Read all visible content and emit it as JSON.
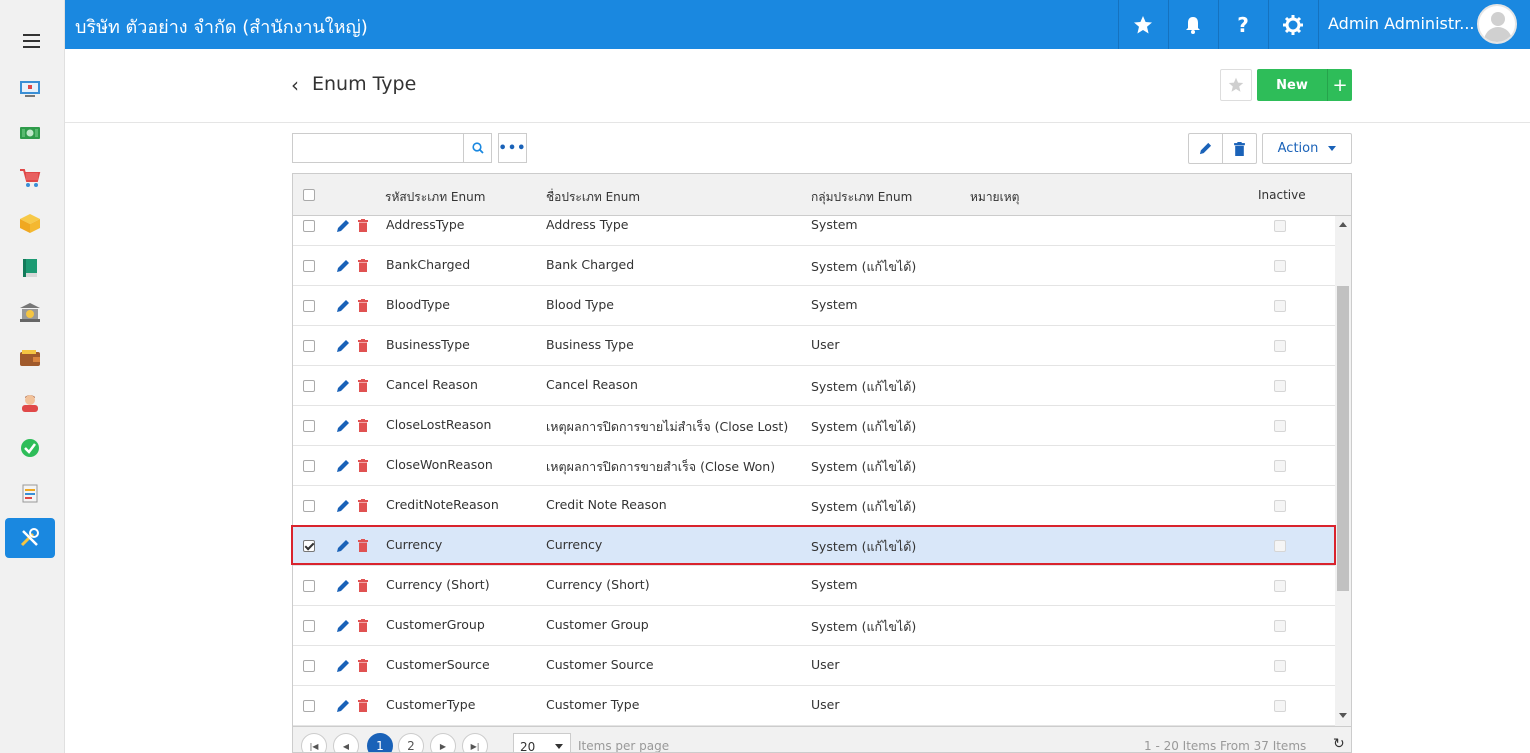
{
  "header": {
    "company": "บริษัท ตัวอย่าง จำกัด (สำนักงานใหญ่)",
    "user_name": "Admin Administr..."
  },
  "sidebar": {
    "items": [
      "dashboard-icon",
      "money-icon",
      "cart-icon",
      "box-icon",
      "book-icon",
      "bank-icon",
      "wallet-icon",
      "people-icon",
      "check-circle-icon",
      "report-icon",
      "tools-icon"
    ],
    "active_index": 10
  },
  "page": {
    "title": "Enum Type",
    "new_label": "New",
    "new_plus": "+",
    "action_label": "Action",
    "search_placeholder": ""
  },
  "grid": {
    "columns": {
      "code": "รหัสประเภท Enum",
      "name": "ชื่อประเภท Enum",
      "group": "กลุ่มประเภท Enum",
      "note": "หมายเหตุ",
      "inactive": "Inactive"
    },
    "rows": [
      {
        "code": "AddressType",
        "name": "Address Type",
        "group": "System",
        "note": "",
        "selected": false
      },
      {
        "code": "BankCharged",
        "name": "Bank Charged",
        "group": "System (แก้ไขได้)",
        "note": "",
        "selected": false
      },
      {
        "code": "BloodType",
        "name": "Blood Type",
        "group": "System",
        "note": "",
        "selected": false
      },
      {
        "code": "BusinessType",
        "name": "Business Type",
        "group": "User",
        "note": "",
        "selected": false
      },
      {
        "code": "Cancel Reason",
        "name": "Cancel Reason",
        "group": "System (แก้ไขได้)",
        "note": "",
        "selected": false
      },
      {
        "code": "CloseLostReason",
        "name": "เหตุผลการปิดการขายไม่สำเร็จ (Close Lost)",
        "group": "System (แก้ไขได้)",
        "note": "",
        "selected": false
      },
      {
        "code": "CloseWonReason",
        "name": "เหตุผลการปิดการขายสำเร็จ (Close Won)",
        "group": "System (แก้ไขได้)",
        "note": "",
        "selected": false
      },
      {
        "code": "CreditNoteReason",
        "name": "Credit Note Reason",
        "group": "System (แก้ไขได้)",
        "note": "",
        "selected": false
      },
      {
        "code": "Currency",
        "name": "Currency",
        "group": "System (แก้ไขได้)",
        "note": "",
        "selected": true
      },
      {
        "code": "Currency (Short)",
        "name": "Currency (Short)",
        "group": "System",
        "note": "",
        "selected": false
      },
      {
        "code": "CustomerGroup",
        "name": "Customer Group",
        "group": "System (แก้ไขได้)",
        "note": "",
        "selected": false
      },
      {
        "code": "CustomerSource",
        "name": "Customer Source",
        "group": "User",
        "note": "",
        "selected": false
      },
      {
        "code": "CustomerType",
        "name": "Customer Type",
        "group": "User",
        "note": "",
        "selected": false
      }
    ]
  },
  "pager": {
    "pages": [
      "1",
      "2"
    ],
    "current": "1",
    "page_size": "20",
    "page_size_label": "Items per page",
    "info": "1 - 20 Items From 37 Items"
  },
  "colors": {
    "primary": "#1a88e0",
    "success": "#2ebd59",
    "danger": "#e05252",
    "selected_row": "#d9e7f9",
    "selected_outline": "#d9232d"
  }
}
